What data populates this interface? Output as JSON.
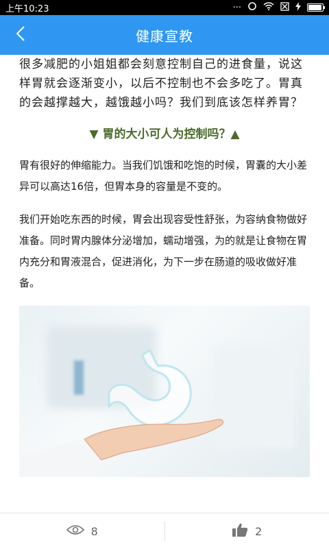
{
  "status_bar": {
    "time": "上午10:23",
    "icons": [
      "more-dots-icon",
      "sync-icon",
      "wifi-icon",
      "no-sim-icon",
      "charging-icon",
      "battery-icon"
    ],
    "battery_level": 0.85
  },
  "app_bar": {
    "back_icon": "chevron-left-icon",
    "title": "健康宣教",
    "background_color": "#2f97f1"
  },
  "article": {
    "intro": "很多减肥的小姐姐都会刻意控制自己的进食量，说这样胃就会逐渐变小，以后不控制也不会多吃了。胃真的会越撑越大，越饿越小吗？我们到底该怎样养胃？",
    "section_heading": "▼ 胃的大小可人为控制吗？▲",
    "heading_color": "#4a6b2a",
    "paragraphs": [
      "胃有很好的伸缩能力。当我们饥饿和吃饱的时候，胃囊的大小差异可以高达16倍，但胃本身的容量是不变的。",
      "我们开始吃东西的时候，胃会出现容受性舒张，为容纳食物做好准备。同时胃内腺体分泌增加，蠕动增强，为的就是让食物在胃内充分和胃液混合，促进消化，为下一步在肠道的吸收做好准备。"
    ],
    "image_description": "stomach-in-hand-illustration"
  },
  "bottom_bar": {
    "views_icon": "eye-icon",
    "views_count": "8",
    "likes_icon": "thumbs-up-icon",
    "likes_count": "2"
  }
}
